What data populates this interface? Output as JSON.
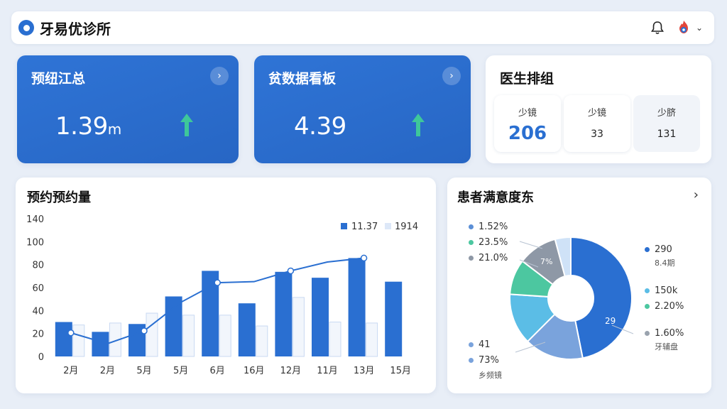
{
  "app": {
    "title": "牙易优诊所"
  },
  "cards": [
    {
      "title": "预纽江总",
      "value": "1.39",
      "unit": "m"
    },
    {
      "title": "贫数据看板",
      "value": "4.39",
      "unit": ""
    }
  ],
  "doctors": {
    "title": "医生排组",
    "items": [
      {
        "label": "少镜",
        "value": "206"
      },
      {
        "label": "少镜",
        "value": "33"
      },
      {
        "label": "少脐",
        "value": "131"
      }
    ]
  },
  "bar_section": {
    "title": "预约预约量"
  },
  "chart_data": {
    "type": "bar",
    "categories": [
      "2月",
      "2月",
      "5月",
      "5月",
      "6月",
      "16月",
      "12月",
      "11月",
      "13月",
      "15月"
    ],
    "ylim": [
      0,
      140
    ],
    "yticks": [
      "0",
      "20",
      "40",
      "60",
      "80",
      "100",
      "140"
    ],
    "ytick_values": [
      0,
      20,
      40,
      60,
      80,
      100,
      120
    ],
    "series": [
      {
        "name": "11.37",
        "color": "#2a6fd1",
        "values": [
          35,
          25,
          33,
          61,
          87,
          54,
          86,
          80,
          100,
          76
        ]
      },
      {
        "name": "1914",
        "color": "#dde8f8",
        "values": [
          32,
          34,
          44,
          42,
          42,
          31,
          60,
          35,
          34,
          null
        ]
      }
    ],
    "line": {
      "color": "#2a6fd1",
      "values": [
        24,
        13,
        26,
        55,
        75,
        76,
        87,
        96,
        100,
        null
      ]
    }
  },
  "satisfaction": {
    "title": "患者满意度东",
    "left_legend": [
      {
        "text": "1.52%",
        "color": "#5b8fd6"
      },
      {
        "text": "23.5%",
        "color": "#4cc7a0"
      },
      {
        "text": "21.0%",
        "color": "#8e98a6"
      }
    ],
    "bottom_left_legend": [
      {
        "text": "41",
        "color": "#7aa3dc"
      },
      {
        "text": "73%",
        "color": "#7aa3dc"
      }
    ],
    "bottom_left_sub": "乡频镜",
    "right_legend_top": [
      {
        "text": "290",
        "color": "#2a6fd1"
      }
    ],
    "right_sub_top": "8.4期",
    "right_legend_mid": [
      {
        "text": "150k",
        "color": "#5bbde6"
      },
      {
        "text": "2.20%",
        "color": "#4cc7a0"
      }
    ],
    "right_legend_bottom": [
      {
        "text": "1.60%",
        "color": "#9aa3ae"
      }
    ],
    "right_sub_bottom": "牙辅盘",
    "slice_label_center": "29",
    "slice_label_top": "7%",
    "pie_values": [
      45,
      15,
      13,
      9,
      10,
      4
    ],
    "pie_colors": [
      "#2a6fd1",
      "#7aa3dc",
      "#5bbde6",
      "#4cc7a0",
      "#8e98a6",
      "#cfe2f7"
    ]
  }
}
